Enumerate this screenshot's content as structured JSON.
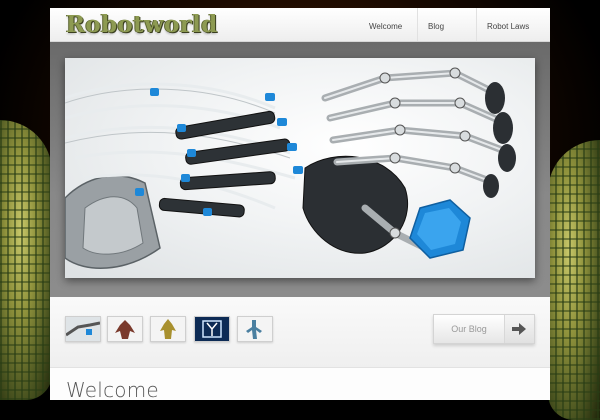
{
  "site": {
    "logo_text": "Robotworld"
  },
  "nav": {
    "items": [
      {
        "label": "Welcome"
      },
      {
        "label": "Blog"
      },
      {
        "label": "Robot Laws"
      }
    ]
  },
  "hero": {
    "icon": "robot-hand-illustration"
  },
  "thumbnails": [
    {
      "icon": "robot-arm-thumbnail"
    },
    {
      "icon": "red-robot-thumbnail"
    },
    {
      "icon": "yellow-robot-thumbnail"
    },
    {
      "icon": "x-ray-robot-thumbnail"
    },
    {
      "icon": "blue-robot-thumbnail"
    }
  ],
  "blog_button": {
    "label": "Our Blog",
    "icon": "arrow-right-icon"
  },
  "content": {
    "title": "Welcome"
  },
  "colors": {
    "logo": "#8d9a52",
    "accent_blue": "#1e88d8",
    "background": "#000000"
  }
}
